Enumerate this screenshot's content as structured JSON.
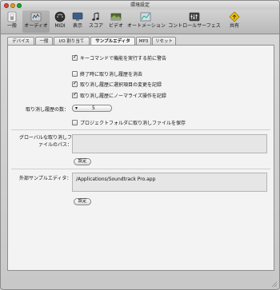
{
  "window": {
    "title": "環境設定"
  },
  "toolbar": {
    "items": [
      {
        "label": "一般",
        "icon": "switch-icon"
      },
      {
        "label": "オーディオ",
        "icon": "audio-icon",
        "selected": true
      },
      {
        "label": "MIDI",
        "icon": "midi-icon"
      },
      {
        "label": "表示",
        "icon": "display-icon"
      },
      {
        "label": "スコア",
        "icon": "score-icon"
      },
      {
        "label": "ビデオ",
        "icon": "video-icon"
      },
      {
        "label": "オートメーション",
        "icon": "automation-icon"
      },
      {
        "label": "コントロールサーフェス",
        "icon": "control-surface-icon"
      },
      {
        "label": "共有",
        "icon": "share-icon"
      }
    ]
  },
  "tabs": [
    {
      "label": "デバイス"
    },
    {
      "label": "一般"
    },
    {
      "label": "I/O 割り当て"
    },
    {
      "label": "サンプルエディタ",
      "active": true
    },
    {
      "label": "MP3"
    },
    {
      "label": "リセット"
    }
  ],
  "options": {
    "warn_key_command": {
      "label": "キーコマンドで機能を実行する前に警告",
      "checked": true
    },
    "clear_undo_on_quit": {
      "label": "終了時に取り消し履歴を消去",
      "checked": false
    },
    "undo_selection_changes": {
      "label": "取り消し履歴に選択項目の変更を記録",
      "checked": true
    },
    "undo_normalize": {
      "label": "取り消し履歴にノーマライズ操作を記録",
      "checked": true
    },
    "undo_steps_label": "取り消し履歴の数：",
    "undo_steps_value": "5",
    "save_undo_in_project": {
      "label": "プロジェクトフォルダに取り消しファイルを保存",
      "checked": false
    }
  },
  "global_undo_path": {
    "label": "グローバルな取り消しファイルのパス：",
    "value": "",
    "button": "設定"
  },
  "external_editor": {
    "label": "外部サンプルエディタ：",
    "value": "/Applications/Soundtrack Pro.app",
    "button": "設定"
  },
  "colors": {
    "close": "#e0443e",
    "minimize": "#dea123",
    "zoom": "#1aab29"
  }
}
